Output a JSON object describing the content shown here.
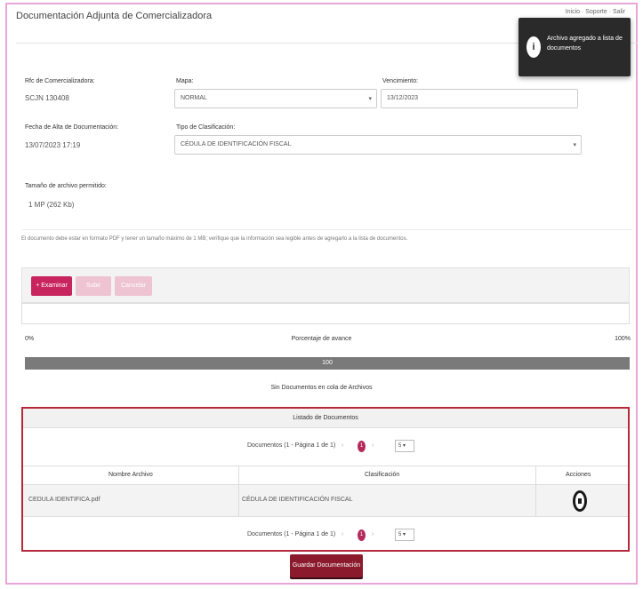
{
  "header": {
    "title": "Documentación Adjunta de Comercializadora",
    "toplinks": "Inicio · Soporte · Salir"
  },
  "toast": {
    "icon": "info-icon",
    "message": "Archivo agregado a lista de documentos"
  },
  "form": {
    "rfc_label": "Rfc de Comercializadora:",
    "rfc_value": "SCJN 130408",
    "mapa_label": "Mapa:",
    "mapa_value": "NORMAL",
    "vencimiento_label": "Vencimiento:",
    "vencimiento_value": "13/12/2023",
    "fecha_label": "Fecha de Alta de Documentación:",
    "fecha_value": "13/07/2023 17:19",
    "tipo_label": "Tipo de Clasificación:",
    "tipo_value": "CÉDULA DE IDENTIFICACIÓN FISCAL",
    "tamano_label": "Tamaño de archivo permitido:",
    "tamano_value": "1 MP (262 Kb)"
  },
  "note": "El documento debe estar en formato PDF y tener un tamaño máximo de 1 MB; verifique que la información sea legible antes de agregarlo a la lista de documentos.",
  "upload": {
    "choose_label": "+ Examinar",
    "upload_label": "Subir",
    "cancel_label": "Cancelar"
  },
  "progress": {
    "min_label": "0%",
    "title": "Porcentaje de avance",
    "max_label": "100%",
    "value": 100,
    "bar_label": "100",
    "status_text": "Sin Documentos en cola de Archivos"
  },
  "table": {
    "title": "Listado de Documentos",
    "pager_text": "Documentos (1 - Página 1 de 1)",
    "page": "1",
    "prev": "‹",
    "next": "›",
    "page_size": "5 ▾",
    "columns": [
      "Nombre Archivo",
      "Clasificación",
      "Acciones"
    ],
    "rows": [
      {
        "file": "CEDULA IDENTIFICA.pdf",
        "classification": "CÉDULA DE IDENTIFICACIÓN FISCAL",
        "action_icon": "delete-icon"
      }
    ]
  },
  "save_button": "Guardar Documentación",
  "colors": {
    "accent": "#c8255e",
    "table_border": "#b52a3b",
    "toast_bg": "#2a2a2a"
  }
}
